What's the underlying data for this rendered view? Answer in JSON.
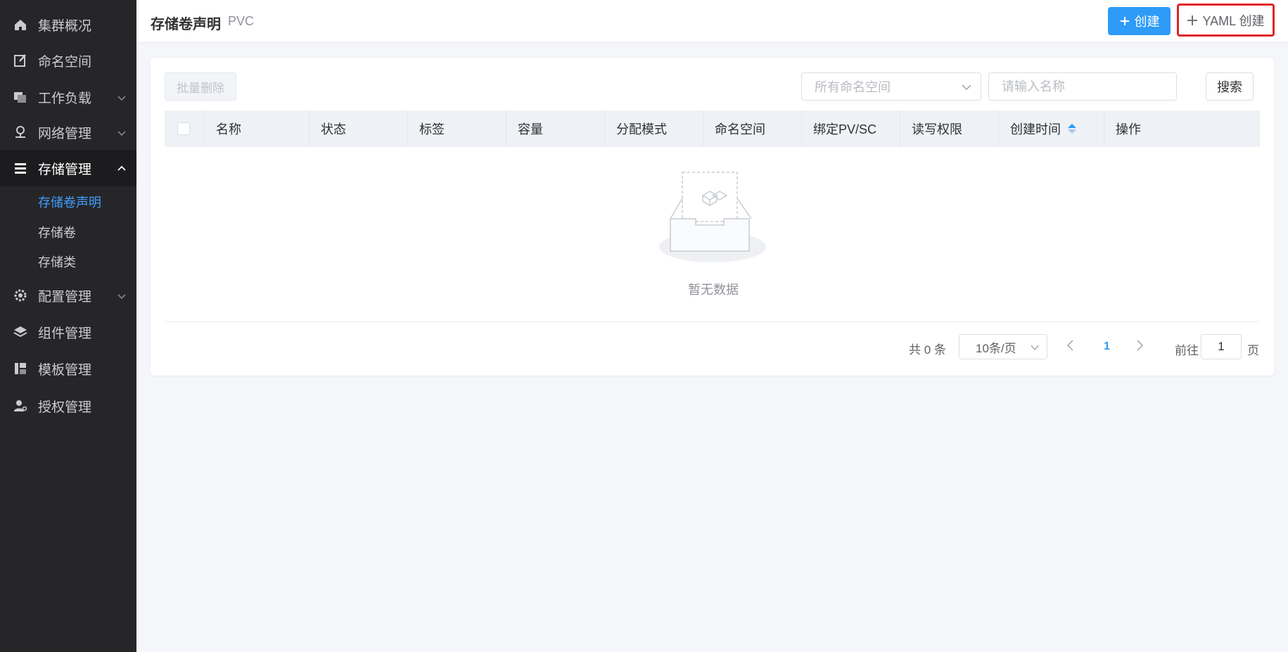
{
  "sidebar": {
    "items": [
      {
        "label": "集群概况",
        "icon": "home-icon"
      },
      {
        "label": "命名空间",
        "icon": "edit-icon"
      },
      {
        "label": "工作负载",
        "icon": "copy-icon"
      },
      {
        "label": "网络管理",
        "icon": "network-icon"
      },
      {
        "label": "存储管理",
        "icon": "storage-icon"
      },
      {
        "label": "配置管理",
        "icon": "gear-icon"
      },
      {
        "label": "组件管理",
        "icon": "layers-icon"
      },
      {
        "label": "模板管理",
        "icon": "template-icon"
      },
      {
        "label": "授权管理",
        "icon": "user-key-icon"
      }
    ],
    "storage_sub": [
      {
        "label": "存储卷声明"
      },
      {
        "label": "存储卷"
      },
      {
        "label": "存储类"
      }
    ]
  },
  "header": {
    "title": "存储卷声明",
    "subtitle": "PVC",
    "create_label": "创建",
    "yaml_create_label": "YAML 创建"
  },
  "toolbar": {
    "batch_delete_label": "批量删除",
    "namespace_placeholder": "所有命名空间",
    "name_placeholder": "请输入名称",
    "search_label": "搜索"
  },
  "table": {
    "columns": [
      "名称",
      "状态",
      "标签",
      "容量",
      "分配模式",
      "命名空间",
      "绑定PV/SC",
      "读写权限",
      "创建时间",
      "操作"
    ],
    "rows": [],
    "empty_text": "暂无数据"
  },
  "pagination": {
    "total_text": "共 0 条",
    "page_size": "10条/页",
    "current_page": "1",
    "goto_label": "前往",
    "goto_value": "1",
    "page_unit": "页"
  },
  "colors": {
    "primary": "#2d9bf7",
    "highlight_border": "#e0232a",
    "sidebar_bg": "#262629"
  }
}
